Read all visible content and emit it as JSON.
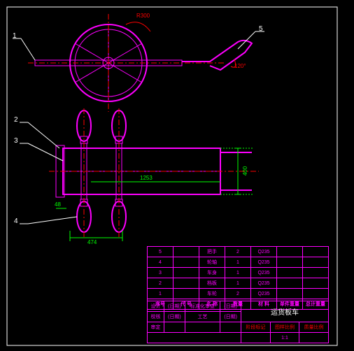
{
  "drawing": {
    "border_color": "#ffffff",
    "part_color": "#ff00ff",
    "centerline_color": "#ff0000",
    "dim_color": "#00ff00",
    "leader_color": "#ffffff"
  },
  "leaders": {
    "l1": "1",
    "l2": "2",
    "l3": "3",
    "l4": "4",
    "l5": "5"
  },
  "angles": {
    "a1": "R300",
    "a2": "120°"
  },
  "dims": {
    "d_width": "474",
    "d_length": "1253",
    "d_overhang": "48",
    "d_height": "400"
  },
  "bom": {
    "headers": {
      "seq": "序号",
      "code": "代 号",
      "name": "名 称",
      "qty": "数量",
      "mat": "材 料",
      "unit": "单件重量",
      "total": "总计重量"
    },
    "rows": [
      {
        "seq": "5",
        "name": "把手",
        "qty": "2",
        "mat": "Q235"
      },
      {
        "seq": "4",
        "name": "轮轴",
        "qty": "1",
        "mat": "Q235"
      },
      {
        "seq": "3",
        "name": "车身",
        "qty": "1",
        "mat": "Q235"
      },
      {
        "seq": "2",
        "name": "档板",
        "qty": "1",
        "mat": "Q235"
      },
      {
        "seq": "1",
        "name": "车轮",
        "qty": "2",
        "mat": "Q235"
      }
    ]
  },
  "title_block": {
    "product": "运货板车",
    "scale_label": "图样比例",
    "scale": "1:1",
    "mass_label": "质量比例",
    "labels": {
      "design": "设计",
      "date": "(日期)",
      "std": "标准化审查",
      "std_date": "(日期)",
      "check": "校核",
      "proc": "工艺",
      "appr": "审定",
      "stage": "阶段标记"
    }
  }
}
